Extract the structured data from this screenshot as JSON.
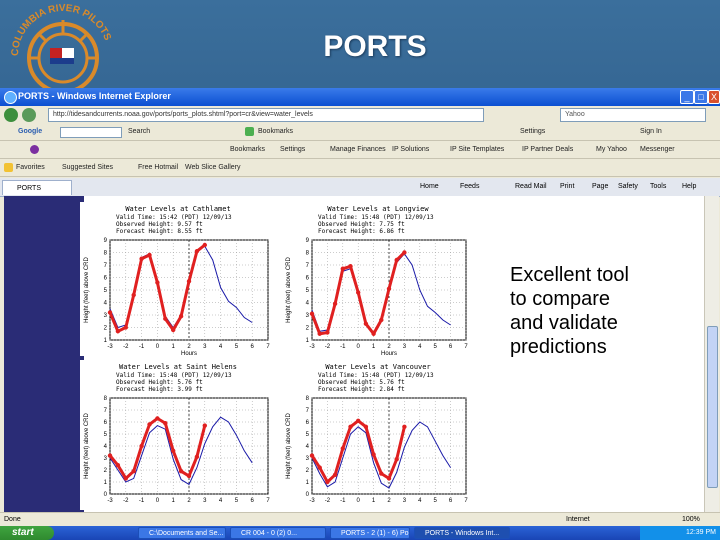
{
  "slide": {
    "title": "PORTS",
    "logo_text": "COLUMBIA RIVER PILOTS",
    "callout": [
      "Excellent tool",
      "to compare",
      "and validate",
      "predictions"
    ]
  },
  "browser": {
    "title": "PORTS - Windows Internet Explorer",
    "address": "http://tidesandcurrents.noaa.gov/ports/ports_plots.shtml?port=cr&view=water_levels",
    "search_engine": "Yahoo",
    "tab_label": "PORTS",
    "google_bar": [
      "Google",
      "Search",
      "Bookmarks",
      "Settings",
      "Sign In"
    ],
    "toolbar": [
      "Bookmarks",
      "Settings",
      "Manage Finances",
      "IP Solutions",
      "IP Site Templates",
      "IP Partner Deals",
      "My Yahoo",
      "Messenger"
    ],
    "favorites": [
      "Favorites",
      "Suggested Sites",
      "Free Hotmail",
      "Web Slice Gallery"
    ],
    "commands": [
      "Home",
      "Feeds",
      "Read Mail",
      "Print",
      "Page",
      "Safety",
      "Tools",
      "Help"
    ],
    "status_left": "Done",
    "status_zone": "Internet",
    "zoom": "100%",
    "window_buttons": [
      "_",
      "□",
      "X"
    ]
  },
  "taskbar": {
    "start_label": "start",
    "tasks": [
      "C:\\Documents and Se...",
      "CR 004 - 0 (2) 0...",
      "PORTS - 2 (1) - 6) Po...",
      "PORTS - Windows Int..."
    ],
    "clock": "12:39 PM"
  },
  "chart_data": [
    {
      "type": "line",
      "title": "Water Levels at Cathlamet",
      "info": [
        "Valid Time: 15:42 (PDT) 12/09/13",
        "Observed Height: 9.57 ft",
        "Forecast Height: 8.55 ft"
      ],
      "ylabel": "Height (feet) above CRD",
      "xlabel": "Hours",
      "xlim": [
        -3,
        7
      ],
      "ylim": [
        1,
        9
      ],
      "xticks": [
        -3,
        -2,
        -1,
        0,
        1,
        2,
        3,
        4,
        5,
        6,
        7
      ],
      "yticks": [
        1,
        2,
        3,
        4,
        5,
        6,
        7,
        8,
        9
      ],
      "forecast_x": [
        -3,
        -2.5,
        -2,
        -1.5,
        -1,
        -0.5,
        0,
        0.5,
        1,
        1.5,
        2,
        2.5,
        3,
        3.5,
        4,
        4.5,
        5,
        5.5,
        6
      ],
      "forecast_y": [
        3.5,
        2.0,
        2.2,
        4.8,
        7.6,
        7.9,
        5.7,
        2.9,
        2.0,
        3.0,
        5.8,
        8.2,
        8.5,
        7.4,
        5.2,
        4.1,
        3.6,
        2.8,
        2.4
      ],
      "observed_x": [
        -3,
        -2.5,
        -2,
        -1.5,
        -1,
        -0.5,
        0,
        0.5,
        1,
        1.5,
        2,
        2.5,
        3
      ],
      "observed_y": [
        3.2,
        1.7,
        2.0,
        4.6,
        7.5,
        7.8,
        5.6,
        2.7,
        1.8,
        2.9,
        5.7,
        8.1,
        8.6
      ]
    },
    {
      "type": "line",
      "title": "Water Levels at Longview",
      "info": [
        "Valid Time: 15:48 (PDT) 12/09/13",
        "Observed Height: 7.75 ft",
        "Forecast Height: 6.86 ft"
      ],
      "ylabel": "Height (feet) above CRD",
      "xlabel": "Hours",
      "xlim": [
        -3,
        7
      ],
      "ylim": [
        1,
        9
      ],
      "xticks": [
        -3,
        -2,
        -1,
        0,
        1,
        2,
        3,
        4,
        5,
        6,
        7
      ],
      "yticks": [
        1,
        2,
        3,
        4,
        5,
        6,
        7,
        8,
        9
      ],
      "forecast_x": [
        -3,
        -2.5,
        -2,
        -1.5,
        -1,
        -0.5,
        0,
        0.5,
        1,
        1.5,
        2,
        2.5,
        3,
        3.5,
        4,
        4.5,
        5,
        5.5,
        6
      ],
      "forecast_y": [
        3.4,
        1.7,
        1.8,
        4.0,
        6.5,
        6.7,
        4.6,
        2.2,
        1.6,
        2.7,
        5.0,
        7.2,
        7.9,
        7.0,
        5.0,
        3.7,
        3.2,
        2.6,
        2.2
      ],
      "observed_x": [
        -3,
        -2.5,
        -2,
        -1.5,
        -1,
        -0.5,
        0,
        0.5,
        1,
        1.5,
        2,
        2.5,
        3
      ],
      "observed_y": [
        3.1,
        1.5,
        1.6,
        3.9,
        6.7,
        6.9,
        4.8,
        2.3,
        1.5,
        2.6,
        5.1,
        7.4,
        8.0
      ]
    },
    {
      "type": "line",
      "title": "Water Levels at Saint Helens",
      "info": [
        "Valid Time: 15:48 (PDT) 12/09/13",
        "Observed Height: 5.76 ft",
        "Forecast Height: 3.99 ft"
      ],
      "ylabel": "Height (feet) above CRD",
      "xlabel": "",
      "xlim": [
        -3,
        7
      ],
      "ylim": [
        0,
        8
      ],
      "xticks": [
        -3,
        -2,
        -1,
        0,
        1,
        2,
        3,
        4,
        5,
        6,
        7
      ],
      "yticks": [
        0,
        1,
        2,
        3,
        4,
        5,
        6,
        7,
        8
      ],
      "forecast_x": [
        -3,
        -2.5,
        -2,
        -1.5,
        -1,
        -0.5,
        0,
        0.5,
        1,
        1.5,
        2,
        2.5,
        3,
        3.5,
        4,
        4.5,
        5,
        5.5,
        6
      ],
      "forecast_y": [
        3.0,
        2.0,
        1.0,
        1.3,
        3.2,
        5.1,
        5.7,
        5.4,
        2.9,
        1.2,
        0.8,
        2.2,
        4.2,
        5.6,
        6.4,
        6.0,
        4.9,
        3.6,
        2.6
      ],
      "observed_x": [
        -3,
        -2.5,
        -2,
        -1.5,
        -1,
        -0.5,
        0,
        0.5,
        1,
        1.5,
        2,
        2.5,
        3
      ],
      "observed_y": [
        3.2,
        2.4,
        1.3,
        1.9,
        4.0,
        5.8,
        6.3,
        5.9,
        3.6,
        1.9,
        1.5,
        3.1,
        5.7
      ]
    },
    {
      "type": "line",
      "title": "Water Levels at Vancouver",
      "info": [
        "Valid Time: 15:48 (PDT) 12/09/13",
        "Observed Height: 5.76 ft",
        "Forecast Height: 2.84 ft"
      ],
      "ylabel": "Height (feet) above CRD",
      "xlabel": "",
      "xlim": [
        -3,
        7
      ],
      "ylim": [
        0,
        8
      ],
      "xticks": [
        -3,
        -2,
        -1,
        0,
        1,
        2,
        3,
        4,
        5,
        6,
        7
      ],
      "yticks": [
        0,
        1,
        2,
        3,
        4,
        5,
        6,
        7,
        8
      ],
      "forecast_x": [
        -3,
        -2.5,
        -2,
        -1.5,
        -1,
        -0.5,
        0,
        0.5,
        1,
        1.5,
        2,
        2.5,
        3,
        3.5,
        4,
        4.5,
        5,
        5.5,
        6
      ],
      "forecast_y": [
        3.0,
        1.7,
        0.6,
        1.0,
        3.0,
        5.0,
        5.6,
        5.1,
        2.6,
        0.9,
        0.5,
        1.8,
        3.9,
        5.3,
        6.0,
        5.6,
        4.4,
        3.2,
        2.2
      ],
      "observed_x": [
        -3,
        -2.5,
        -2,
        -1.5,
        -1,
        -0.5,
        0,
        0.5,
        1,
        1.5,
        2,
        2.5,
        3
      ],
      "observed_y": [
        3.2,
        2.2,
        1.0,
        1.6,
        3.8,
        5.6,
        6.1,
        5.6,
        3.3,
        1.7,
        1.3,
        2.9,
        5.6
      ]
    }
  ],
  "colors": {
    "forecast": "#1a1aa8",
    "observed": "#e02020",
    "slide_bg": "#2f5f8c",
    "page_band": "#2a2c76"
  }
}
